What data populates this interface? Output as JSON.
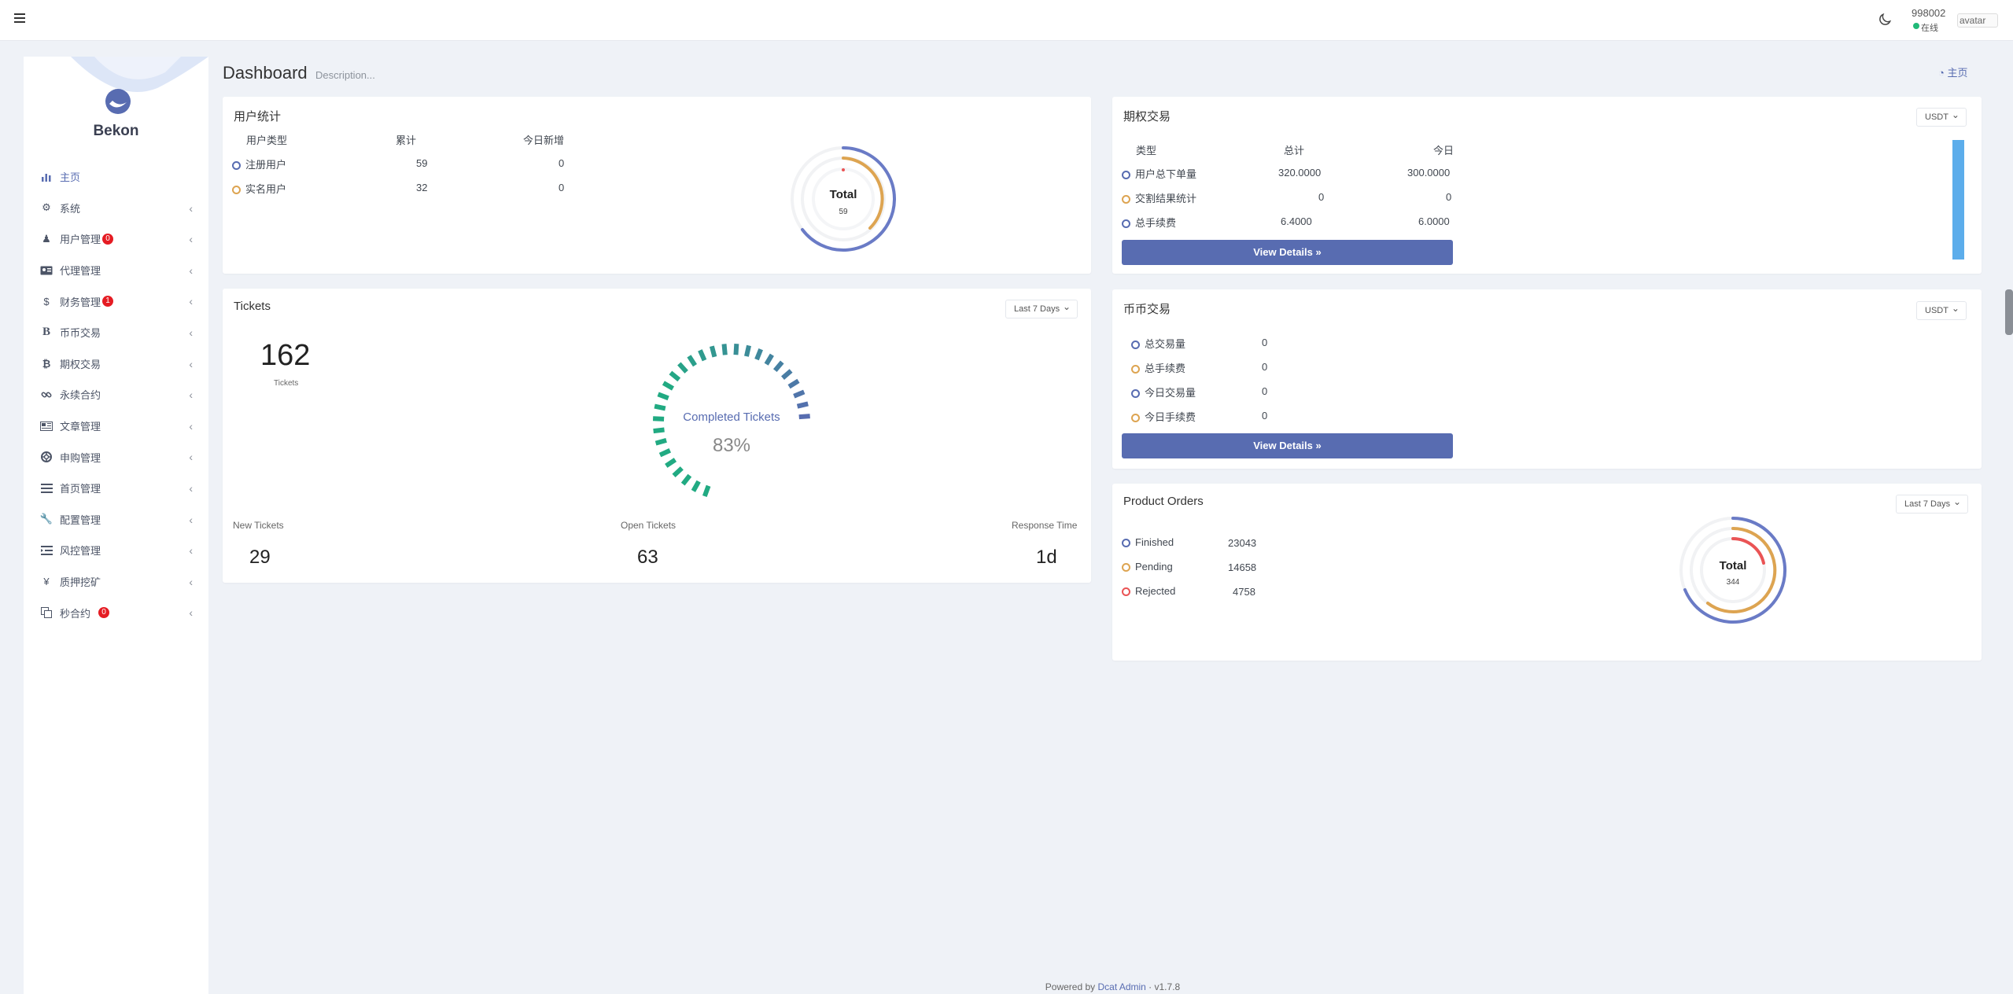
{
  "navbar": {
    "user_id": "998002",
    "status": "在线",
    "avatar_alt": "avatar"
  },
  "sidebar": {
    "brand": "Bekon",
    "items": [
      {
        "label": "主页",
        "icon": "bar-chart-icon",
        "active": true
      },
      {
        "label": "系统",
        "icon": "gear-icon"
      },
      {
        "label": "用户管理",
        "icon": "user-icon",
        "badge": "0"
      },
      {
        "label": "代理管理",
        "icon": "id-card-icon"
      },
      {
        "label": "财务管理",
        "icon": "dollar-icon",
        "badge": "1"
      },
      {
        "label": "币币交易",
        "icon": "bold-b-icon"
      },
      {
        "label": "期权交易",
        "icon": "bitcoin-icon"
      },
      {
        "label": "永续合约",
        "icon": "link-icon"
      },
      {
        "label": "文章管理",
        "icon": "newspaper-icon"
      },
      {
        "label": "申购管理",
        "icon": "lifebuoy-icon"
      },
      {
        "label": "首页管理",
        "icon": "list-icon"
      },
      {
        "label": "配置管理",
        "icon": "wrench-icon"
      },
      {
        "label": "风控管理",
        "icon": "indent-icon"
      },
      {
        "label": "质押挖矿",
        "icon": "yen-icon"
      },
      {
        "label": "秒合约",
        "icon": "copy-icon",
        "badge": "0"
      }
    ]
  },
  "header": {
    "title": "Dashboard",
    "description": "Description...",
    "breadcrumb": "主页"
  },
  "user_stats": {
    "title": "用户统计",
    "columns": [
      "用户类型",
      "累计",
      "今日新增"
    ],
    "rows": [
      {
        "type": "注册用户",
        "total": "59",
        "today": "0"
      },
      {
        "type": "实名用户",
        "total": "32",
        "today": "0"
      }
    ],
    "donut_label": "Total",
    "donut_value": "59"
  },
  "options": {
    "title": "期权交易",
    "currency": "USDT",
    "columns": [
      "类型",
      "总计",
      "今日"
    ],
    "rows": [
      {
        "type": "用户总下单量",
        "total": "320.0000",
        "today": "300.0000"
      },
      {
        "type": "交割结果统计",
        "total": "0",
        "today": "0"
      },
      {
        "type": "总手续费",
        "total": "6.4000",
        "today": "6.0000"
      }
    ],
    "button": "View Details »"
  },
  "tickets": {
    "title": "Tickets",
    "range": "Last 7 Days",
    "total": "162",
    "total_label": "Tickets",
    "gauge_label": "Completed Tickets",
    "gauge_value": "83%",
    "gauge_fraction": 0.83,
    "stats": [
      {
        "label": "New Tickets",
        "value": "29"
      },
      {
        "label": "Open Tickets",
        "value": "63"
      },
      {
        "label": "Response Time",
        "value": "1d"
      }
    ]
  },
  "coin": {
    "title": "币币交易",
    "currency": "USDT",
    "rows": [
      {
        "label": "总交易量",
        "value": "0"
      },
      {
        "label": "总手续费",
        "value": "0"
      },
      {
        "label": "今日交易量",
        "value": "0"
      },
      {
        "label": "今日手续费",
        "value": "0"
      }
    ],
    "button": "View Details »"
  },
  "orders": {
    "title": "Product Orders",
    "range": "Last 7 Days",
    "rows": [
      {
        "label": "Finished",
        "value": "23043"
      },
      {
        "label": "Pending",
        "value": "14658"
      },
      {
        "label": "Rejected",
        "value": "4758"
      }
    ],
    "donut_label": "Total",
    "donut_value": "344"
  },
  "footer": {
    "prefix": "Powered by ",
    "link": "Dcat Admin",
    "version": " · v1.7.8"
  },
  "colors": {
    "primary": "#586cb1",
    "orange": "#dda451",
    "red": "#ea5455",
    "green": "#21b978",
    "bar_blue": "#5cadeb"
  }
}
